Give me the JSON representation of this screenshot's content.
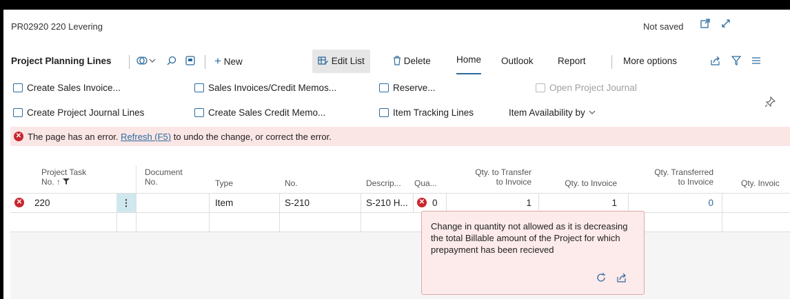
{
  "window": {
    "title": "PR02920 220 Levering",
    "status": "Not saved",
    "icons": [
      "open-in-new-window-icon",
      "expand-icon"
    ]
  },
  "actionbar": {
    "page_title": "Project Planning Lines",
    "new_label": "New",
    "edit_list_label": "Edit List",
    "delete_label": "Delete",
    "home_label": "Home",
    "outlook_label": "Outlook",
    "report_label": "Report",
    "more_options_label": "More options"
  },
  "ribbon": {
    "create_sales_invoice": "Create Sales Invoice...",
    "sales_invoices_credit_memos": "Sales Invoices/Credit Memos...",
    "reserve": "Reserve...",
    "open_project_journal": "Open Project Journal",
    "create_project_journal_lines": "Create Project Journal Lines",
    "create_sales_credit_memo": "Create Sales Credit Memo...",
    "item_tracking_lines": "Item Tracking Lines",
    "item_availability_by": "Item Availability by"
  },
  "error_bar": {
    "prefix": "The page has an error.",
    "link": "Refresh (F5)",
    "suffix": "to undo the change, or correct the error."
  },
  "grid": {
    "headers": {
      "project_task_no_1": "Project Task",
      "project_task_no_2": "No. ↑",
      "document_no_1": "Document",
      "document_no_2": "No.",
      "type": "Type",
      "no": "No.",
      "description": "Descrip...",
      "quantity": "Qua...",
      "qty_to_transfer_1": "Qty. to Transfer",
      "qty_to_transfer_2": "to Invoice",
      "qty_to_invoice": "Qty. to Invoice",
      "qty_transferred_1": "Qty. Transferred",
      "qty_transferred_2": "to Invoice",
      "qty_invoiced": "Qty. Invoic"
    },
    "row": {
      "project_task_no": "220",
      "type": "Item",
      "no": "S-210",
      "description": "S-210 H...",
      "quantity": "0",
      "qty_to_transfer": "1",
      "qty_to_invoice": "1",
      "qty_transferred": "0"
    }
  },
  "tooltip": {
    "message": "Change in quantity not allowed as it is decreasing the total Billable amount of the Project for which prepayment has been recieved"
  }
}
